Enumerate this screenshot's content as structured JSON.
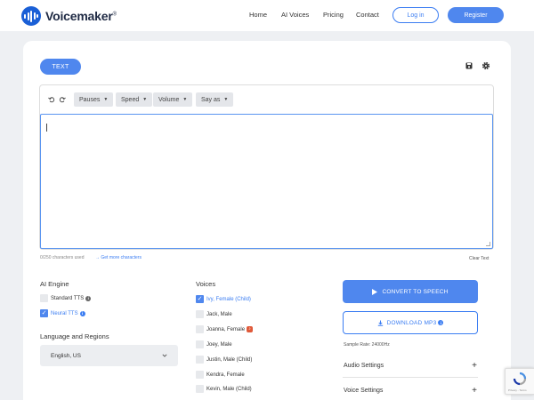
{
  "header": {
    "logo_text": "Voicemaker",
    "logo_mark": "®",
    "nav": [
      "Home",
      "AI Voices",
      "Pricing",
      "Contact"
    ],
    "login_label": "Log in",
    "register_label": "Register"
  },
  "editor": {
    "tab_label": "TEXT",
    "toolbar": [
      "Pauses",
      "Speed",
      "Volume",
      "Say as"
    ],
    "chars_used": "0/250 characters used",
    "more_chars": "→ Get more characters",
    "clear_text": "Clear Text"
  },
  "engine": {
    "label": "AI Engine",
    "options": [
      {
        "label": "Standard TTS",
        "checked": false
      },
      {
        "label": "Neural TTS",
        "checked": true
      }
    ]
  },
  "language": {
    "label": "Language and Regions",
    "selected": "English, US"
  },
  "voices": {
    "label": "Voices",
    "items": [
      {
        "label": "Ivy, Female (Child)",
        "checked": true
      },
      {
        "label": "Jack, Male",
        "checked": false
      },
      {
        "label": "Joanna, Female",
        "checked": false
      },
      {
        "label": "Joey, Male",
        "checked": false
      },
      {
        "label": "Justin, Male (Child)",
        "checked": false
      },
      {
        "label": "Kendra, Female",
        "checked": false
      },
      {
        "label": "Kevin, Male (Child)",
        "checked": false
      }
    ]
  },
  "actions": {
    "convert_label": "CONVERT TO SPEECH",
    "download_label": "DOWNLOAD MP3",
    "sample_rate": "Sample Rate: 24000Hz",
    "accordions": [
      "Audio Settings",
      "Voice Settings"
    ]
  },
  "recaptcha": {
    "text": "Privacy - Terms"
  },
  "colors": {
    "accent": "#4f87ee",
    "brand": "#1a5fd6",
    "badge": "#e05a3a"
  }
}
